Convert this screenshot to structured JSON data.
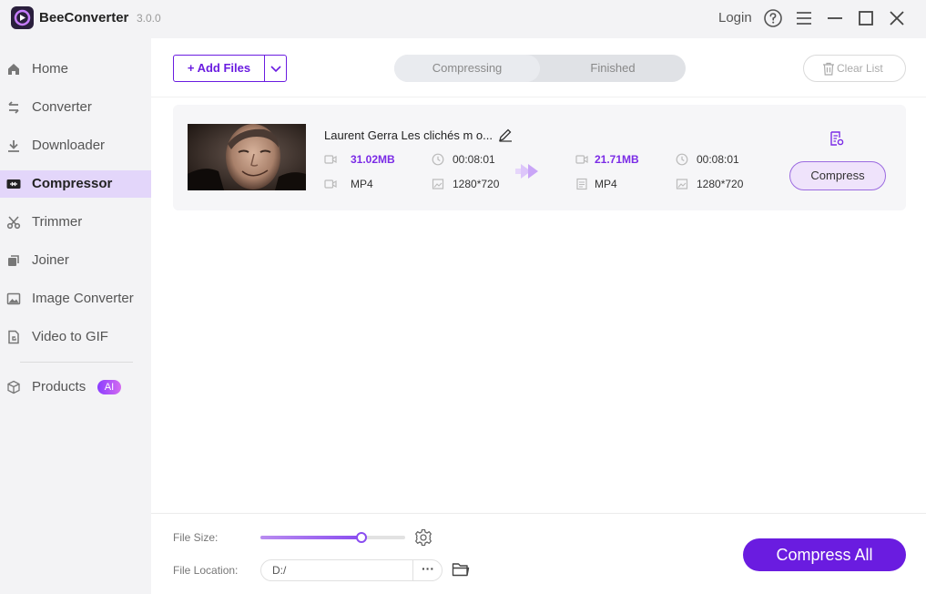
{
  "app": {
    "name": "BeeConverter",
    "version": "3.0.0"
  },
  "titlebar": {
    "login_label": "Login"
  },
  "sidebar": {
    "items": [
      {
        "label": "Home",
        "icon": "home-icon"
      },
      {
        "label": "Converter",
        "icon": "converter-icon"
      },
      {
        "label": "Downloader",
        "icon": "download-icon"
      },
      {
        "label": "Compressor",
        "icon": "compressor-icon",
        "active": true
      },
      {
        "label": "Trimmer",
        "icon": "scissors-icon"
      },
      {
        "label": "Joiner",
        "icon": "joiner-icon"
      },
      {
        "label": "Image Converter",
        "icon": "image-icon"
      },
      {
        "label": "Video to GIF",
        "icon": "gif-icon"
      },
      {
        "label": "Products",
        "icon": "cube-icon"
      }
    ],
    "products_badge": "AI"
  },
  "toolbar": {
    "add_files_label": "+ Add Files",
    "tabs": [
      {
        "label": "Compressing",
        "active": true
      },
      {
        "label": "Finished",
        "active": false
      }
    ],
    "clear_list_label": "Clear List"
  },
  "file": {
    "name": "Laurent Gerra Les clichés m o...",
    "source": {
      "size": "31.02MB",
      "duration": "00:08:01",
      "format": "MP4",
      "resolution": "1280*720"
    },
    "output": {
      "size": "21.71MB",
      "duration": "00:08:01",
      "format": "MP4",
      "resolution": "1280*720"
    },
    "compress_label": "Compress"
  },
  "footer": {
    "file_size_label": "File Size:",
    "file_size_level": 0.7,
    "file_location_label": "File Location:",
    "file_location_value": "D:/",
    "more_label": "···",
    "compress_all_label": "Compress All"
  },
  "colors": {
    "accent": "#6a1ce0",
    "active_nav": "#e3d6fa",
    "size_text": "#7b2ce6"
  }
}
